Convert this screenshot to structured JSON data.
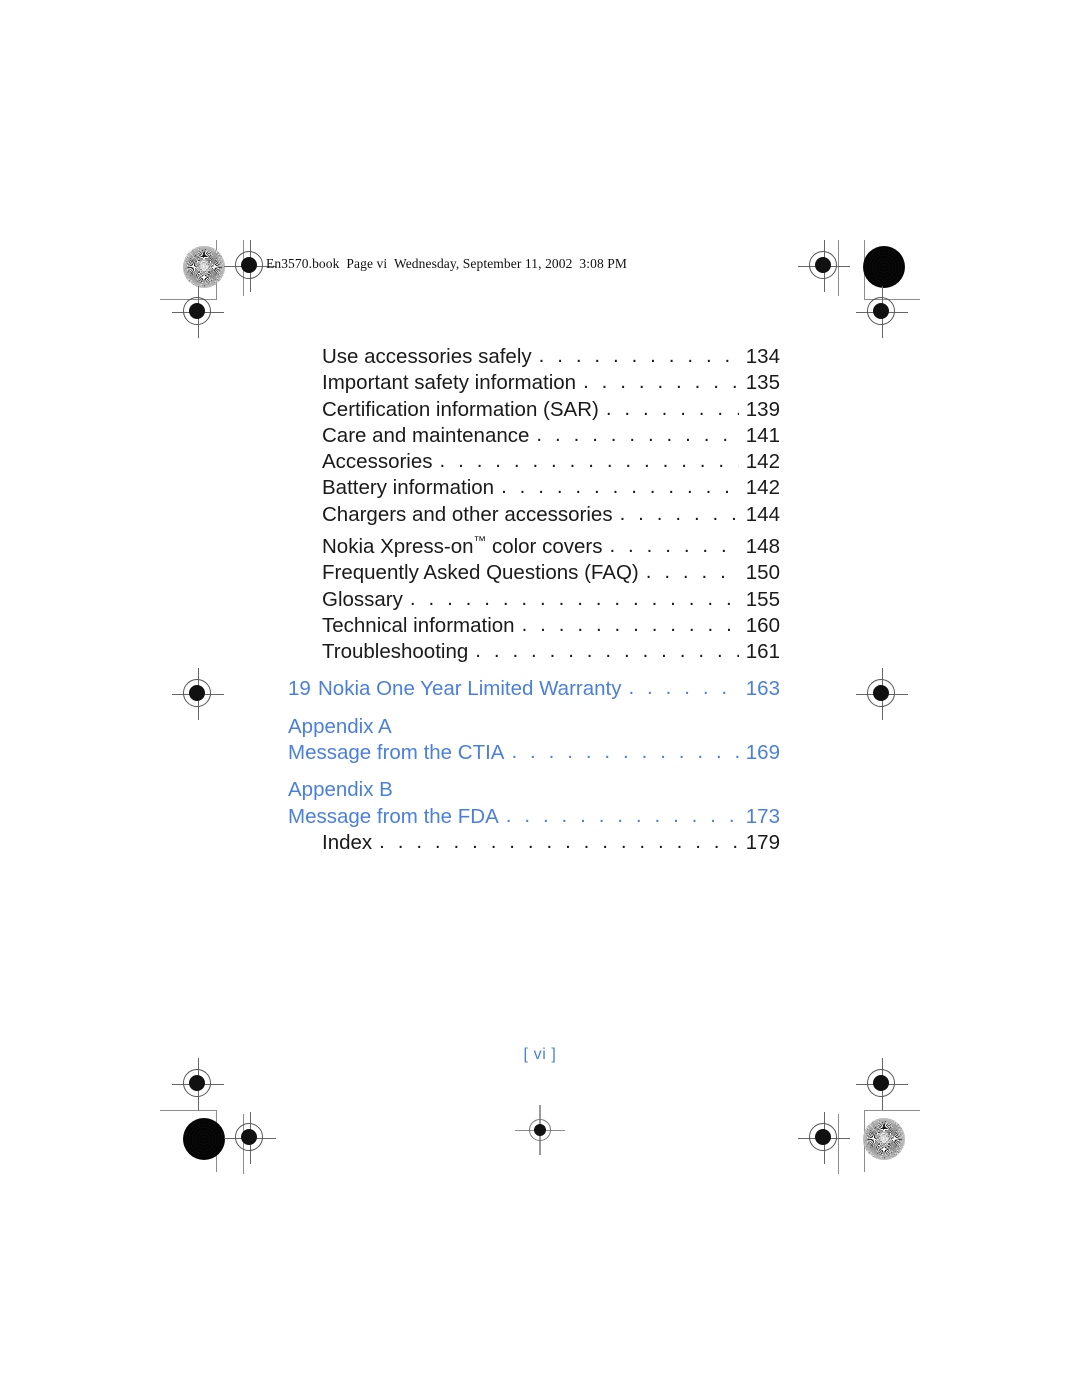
{
  "header": {
    "running_head": "En3570.book  Page vi  Wednesday, September 11, 2002  3:08 PM"
  },
  "colors": {
    "blue_accent": "#4a7fe0",
    "body_text": "#1a1a1a",
    "trim_rule": "#8d8d8d"
  },
  "toc": {
    "leader": ". . . . . . . . . . . . . . . . . . . . . . . . . . . . . . . . . . . . . . . . . . . . . . . . . . . . . . . . . .",
    "entries": [
      {
        "number": "",
        "title": "Use accessories safely",
        "page": "134",
        "style": "plain"
      },
      {
        "number": "",
        "title": "Important safety information",
        "page": "135",
        "style": "plain"
      },
      {
        "number": "",
        "title": "Certification information (SAR)",
        "page": "139",
        "style": "plain"
      },
      {
        "number": "",
        "title": "Care and maintenance",
        "page": "141",
        "style": "plain"
      },
      {
        "number": "",
        "title": "Accessories",
        "page": "142",
        "style": "plain"
      },
      {
        "number": "",
        "title": "Battery information",
        "page": "142",
        "style": "plain"
      },
      {
        "number": "",
        "title": "Chargers and other accessories",
        "page": "144",
        "style": "plain"
      },
      {
        "number": "",
        "title": "Nokia Xpress-on",
        "title_suffix": " color covers",
        "trademark": "™",
        "page": "148",
        "style": "plain-tm"
      },
      {
        "number": "",
        "title": "Frequently Asked Questions (FAQ)",
        "page": "150",
        "style": "plain"
      },
      {
        "number": "",
        "title": "Glossary",
        "page": "155",
        "style": "plain"
      },
      {
        "number": "",
        "title": "Technical information",
        "page": "160",
        "style": "plain"
      },
      {
        "number": "",
        "title": "Troubleshooting",
        "page": "161",
        "style": "plain"
      }
    ],
    "chapter_entry": {
      "number": "19",
      "title": "Nokia One Year Limited Warranty",
      "page": "163"
    },
    "appendices": [
      {
        "heading": "Appendix A",
        "title": "Message from the CTIA",
        "page": "169"
      },
      {
        "heading": "Appendix B",
        "title": "Message from the FDA",
        "page": "173"
      }
    ],
    "index_entry": {
      "title": "Index",
      "page": "179"
    }
  },
  "folio": {
    "label": "[ vi ]"
  }
}
